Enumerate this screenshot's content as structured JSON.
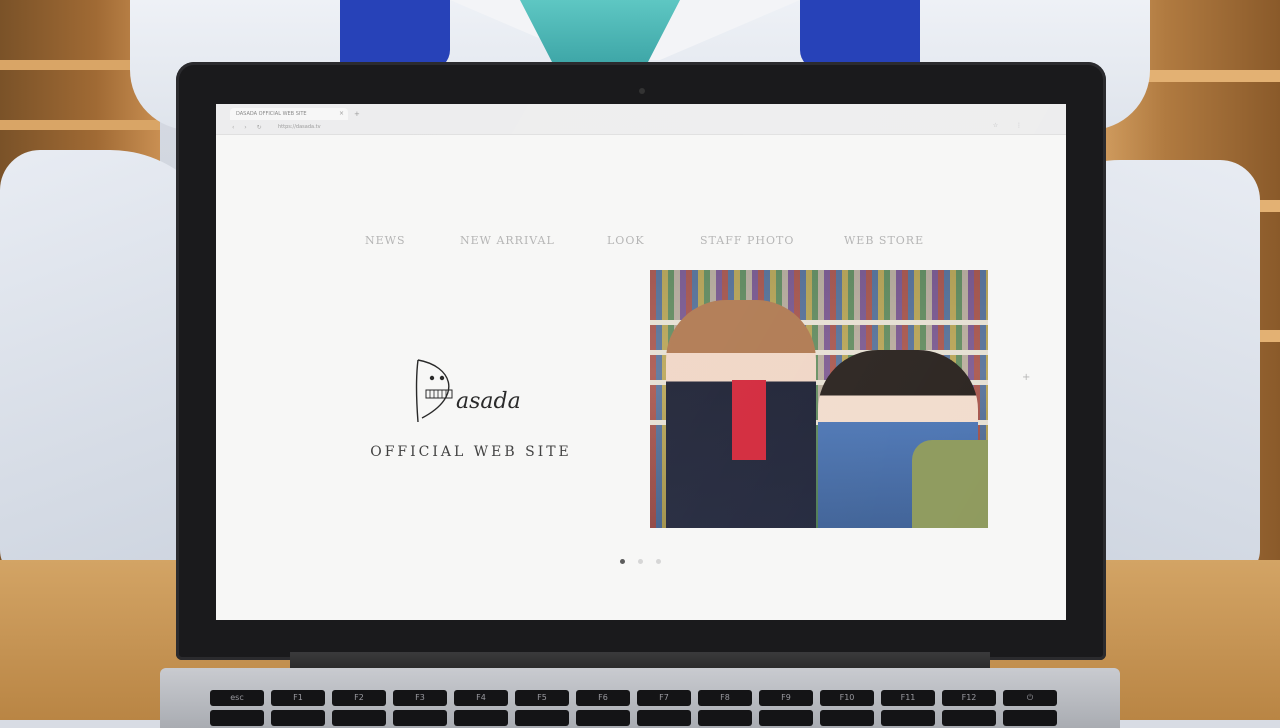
{
  "browser": {
    "tab_title": "DASADA OFFICIAL WEB SITE",
    "tab_close": "×",
    "new_tab": "+",
    "nav_buttons": "‹ › ↻",
    "url": "https://dasada.tv",
    "toolbar_icons": "☆ ⋮"
  },
  "site": {
    "nav": [
      {
        "label": "NEWS"
      },
      {
        "label": "NEW ARRIVAL"
      },
      {
        "label": "LOOK"
      },
      {
        "label": "STAFF PHOTO"
      },
      {
        "label": "WEB STORE"
      }
    ],
    "logo_text": "Dasada",
    "subtitle": "OFFICIAL WEB SITE",
    "hero_next": "+",
    "carousel": {
      "total": 3,
      "active_index": 0
    }
  },
  "colors": {
    "nav_text": "#b3b3b3",
    "subtitle_text": "#3a3a3a",
    "dot_active": "#555555",
    "dot_inactive": "#d4d4d4",
    "page_bg": "#f7f7f6"
  },
  "keyboard": {
    "keys": [
      "esc",
      "F1",
      "F2",
      "F3",
      "F4",
      "F5",
      "F6",
      "F7",
      "F8",
      "F9",
      "F10",
      "F11",
      "F12",
      "⏻"
    ]
  }
}
